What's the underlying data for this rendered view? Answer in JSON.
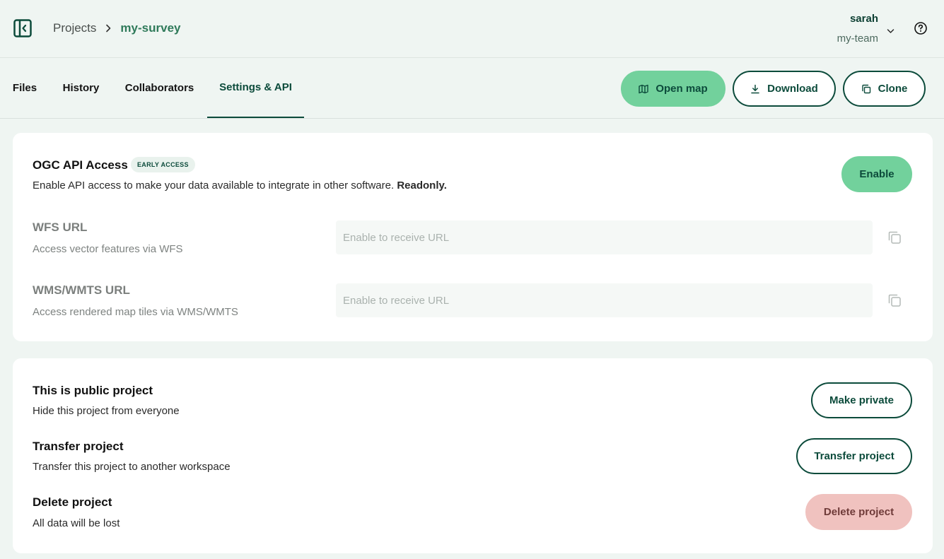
{
  "header": {
    "breadcrumb": {
      "root": "Projects",
      "current": "my-survey"
    },
    "user": {
      "name": "sarah",
      "team": "my-team"
    }
  },
  "tabs": [
    {
      "label": "Files"
    },
    {
      "label": "History"
    },
    {
      "label": "Collaborators"
    },
    {
      "label": "Settings & API",
      "active": true
    }
  ],
  "actions": {
    "open_map": "Open map",
    "download": "Download",
    "clone": "Clone"
  },
  "ogc": {
    "title": "OGC API Access",
    "badge": "EARLY ACCESS",
    "description": "Enable API access to make your data available to integrate in other software.",
    "description_bold": "Readonly.",
    "enable_label": "Enable",
    "wfs": {
      "title": "WFS URL",
      "description": "Access vector features via WFS",
      "placeholder": "Enable to receive URL"
    },
    "wms": {
      "title": "WMS/WMTS URL",
      "description": "Access rendered map tiles via WMS/WMTS",
      "placeholder": "Enable to receive URL"
    }
  },
  "project": {
    "public": {
      "title": "This is public project",
      "description": "Hide this project from everyone",
      "button": "Make private"
    },
    "transfer": {
      "title": "Transfer project",
      "description": "Transfer this project to another workspace",
      "button": "Transfer project"
    },
    "delete": {
      "title": "Delete project",
      "description": "All data will be lost",
      "button": "Delete project"
    }
  },
  "colors": {
    "primary": "#72d19c",
    "dark_green": "#0c4b3b",
    "danger_bg": "#f0c2bf",
    "background": "#eff5f2"
  },
  "icons": [
    "sidebar-toggle-icon",
    "chevron-right-icon",
    "chevron-down-icon",
    "help-icon",
    "map-icon",
    "download-icon",
    "copy-icon"
  ]
}
